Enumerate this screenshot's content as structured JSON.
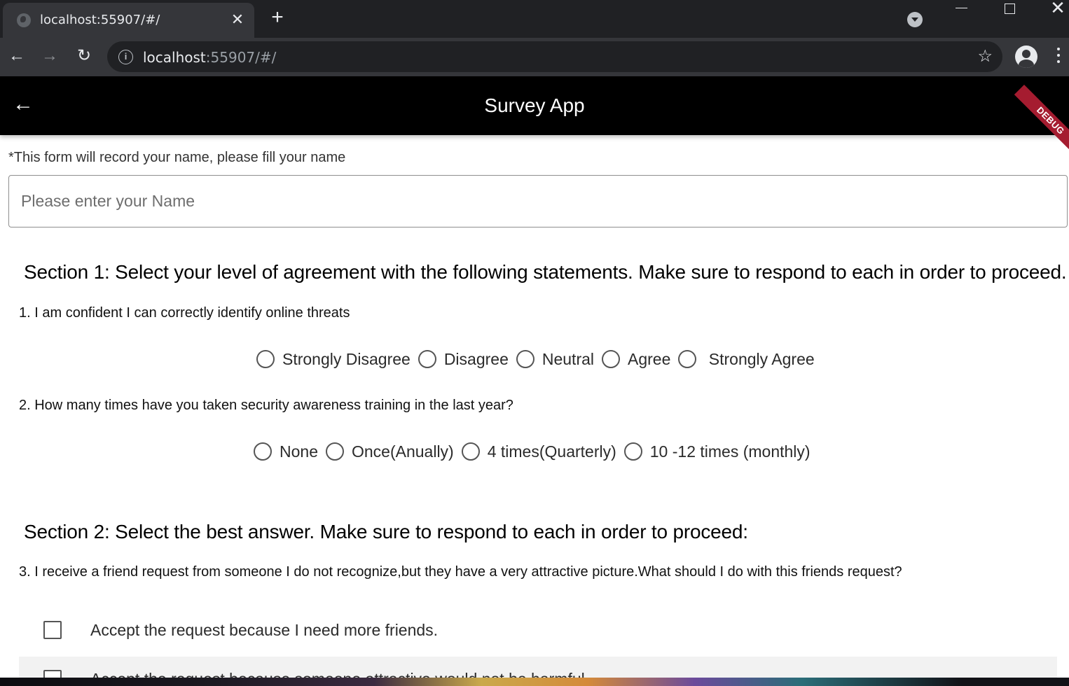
{
  "browser": {
    "tab_title": "localhost:55907/#/",
    "url_host": "localhost",
    "url_rest": ":55907/#/",
    "tab_close_glyph": "✕",
    "new_tab_glyph": "+",
    "window_close_glyph": "✕"
  },
  "app": {
    "title": "Survey App",
    "debug_label": "DEBUG",
    "back_glyph": "←"
  },
  "form": {
    "name_note": "*This form will record your name, please fill your name",
    "name_placeholder": "Please enter your Name",
    "name_value": ""
  },
  "section1": {
    "title": "Section 1:  Select your level of agreement with the following statements. Make sure to respond to each in order to proceed.",
    "q1": {
      "text": "1. I am confident I can correctly identify online threats",
      "options": [
        "Strongly Disagree",
        "Disagree",
        "Neutral",
        "Agree",
        " Strongly Agree"
      ],
      "selected": null
    },
    "q2": {
      "text": "2. How many times have you taken security awareness training in the last year?",
      "options": [
        "None",
        "Once(Anually)",
        "4 times(Quarterly)",
        "10 -12 times (monthly)"
      ],
      "selected": null
    }
  },
  "section2": {
    "title": "Section 2:  Select the best answer. Make sure to respond to each in order to proceed:",
    "q3": {
      "text": "3. I receive a friend request from someone I do not recognize,but they have a very attractive picture.What should I do with this friends request?",
      "options": [
        "Accept the request because I need more friends.",
        "Accept the request because someone attractive would not be harmful."
      ],
      "checked": [
        false,
        false
      ]
    }
  },
  "colors": {
    "appbar": "#000000",
    "debug_banner": "#a51c30",
    "browser_bg": "#202124",
    "toolbar_bg": "#35363a"
  }
}
